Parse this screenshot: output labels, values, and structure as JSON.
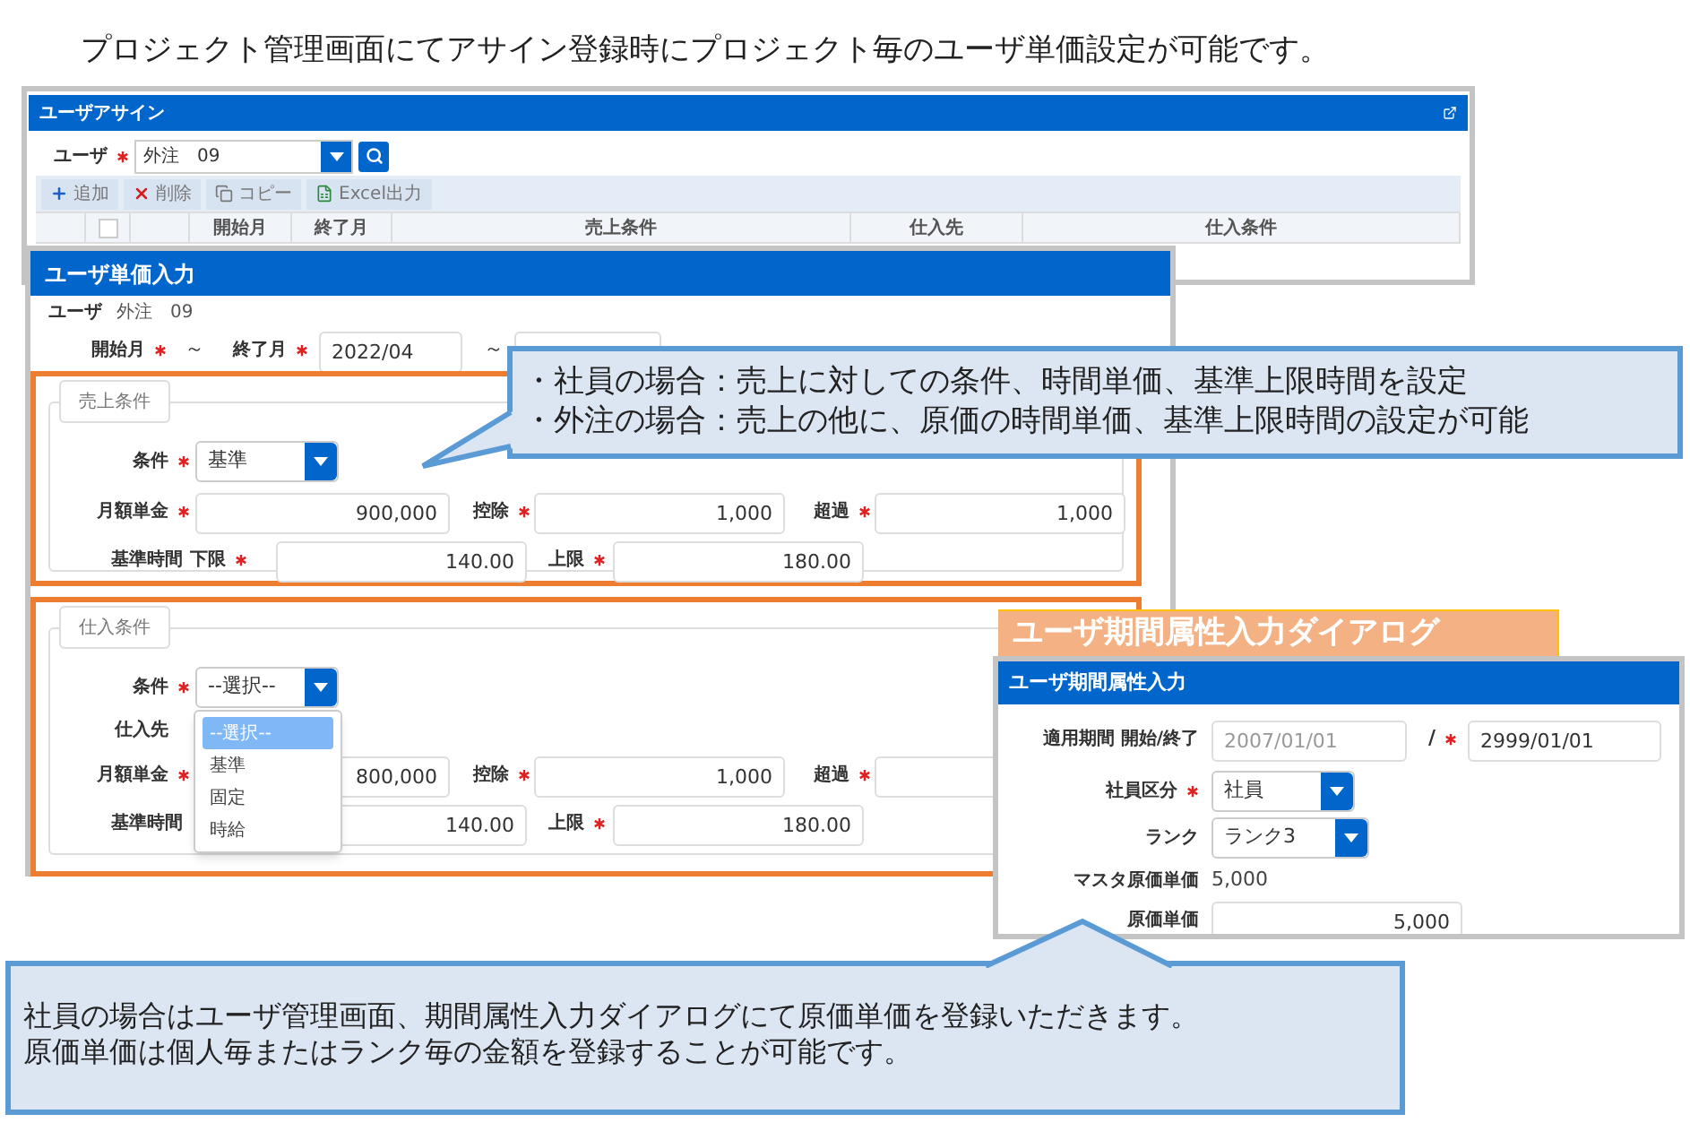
{
  "heading": "プロジェクト管理画面にてアサイン登録時にプロジェクト毎のユーザ単価設定が可能です。",
  "assign_window": {
    "title": "ユーザアサイン",
    "user": {
      "label": "ユーザ",
      "required": true,
      "value": "外注　09"
    },
    "toolbar": [
      {
        "kind": "add",
        "label": "追加"
      },
      {
        "kind": "delete",
        "label": "削除"
      },
      {
        "kind": "copy",
        "label": "コピー"
      },
      {
        "kind": "excel",
        "label": "Excel出力"
      }
    ],
    "table": {
      "header_checkbox": {
        "checked": false
      },
      "columns": [
        "開始月",
        "終了月",
        "売上条件",
        "仕入先",
        "仕入条件"
      ]
    }
  },
  "price_window": {
    "title": "ユーザ単価入力",
    "user_label": "ユーザ",
    "user_value": "外注　09",
    "start": {
      "label": "開始月",
      "required": true
    },
    "tilde": "～",
    "end": {
      "label": "終了月",
      "required": true,
      "value": "2022/04"
    },
    "tilde_2": "～",
    "sections": [
      {
        "legend": "売上条件",
        "condition": {
          "label": "条件",
          "required": true,
          "value": "基準"
        },
        "monthly": {
          "label": "月額単金",
          "required": true,
          "value": "900,000"
        },
        "deduction": {
          "label": "控除",
          "required": true,
          "value": "1,000"
        },
        "excess": {
          "label": "超過",
          "required": true,
          "value": "1,000"
        },
        "base_time_label": "基準時間",
        "lower": {
          "label": "下限",
          "required": true,
          "value": "140.00"
        },
        "upper": {
          "label": "上限",
          "required": true,
          "value": "180.00"
        }
      },
      {
        "legend": "仕入条件",
        "condition": {
          "label": "条件",
          "required": true,
          "value": "--選択--"
        },
        "supplier_label": "仕入先",
        "monthly": {
          "label": "月額単金",
          "required": true,
          "value": "800,000"
        },
        "deduction": {
          "label": "控除",
          "required": true,
          "value": "1,000"
        },
        "excess": {
          "label": "超過",
          "required": true
        },
        "base_time_label": "基準時間",
        "lower": {
          "value": "140.00"
        },
        "upper": {
          "label": "上限",
          "required": true,
          "value": "180.00"
        },
        "dropdown": {
          "expanded": true,
          "options": [
            {
              "label": "--選択--",
              "selected": true
            },
            {
              "label": "基準",
              "selected": false
            },
            {
              "label": "固定",
              "selected": false
            },
            {
              "label": "時給",
              "selected": false
            }
          ]
        }
      }
    ]
  },
  "callout_top": {
    "lines": [
      "・社員の場合：売上に対しての条件、時間単価、基準上限時間を設定",
      "・外注の場合：売上の他に、原価の時間単価、基準上限時間の設定が可能"
    ]
  },
  "dialog_caption": "ユーザ期間属性入力ダイアログ",
  "period_dialog": {
    "title": "ユーザ期間属性入力",
    "period": {
      "label": "適用期間 開始/終了",
      "start_value": "2007/01/01",
      "start_disabled": true,
      "slash": "/",
      "end_required": true,
      "end_value": "2999/01/01"
    },
    "employee_type": {
      "label": "社員区分",
      "required": true,
      "value": "社員"
    },
    "rank": {
      "label": "ランク",
      "value": "ランク3"
    },
    "master_cost": {
      "label": "マスタ原価単価",
      "value": "5,000"
    },
    "cost": {
      "label": "原価単価",
      "value": "5,000"
    }
  },
  "callout_bottom": {
    "lines": [
      "社員の場合はユーザ管理画面、期間属性入力ダイアログにて原価単価を登録いただきます。",
      "原価単価は個人毎またはランク毎の金額を登録することが可能です。"
    ]
  }
}
